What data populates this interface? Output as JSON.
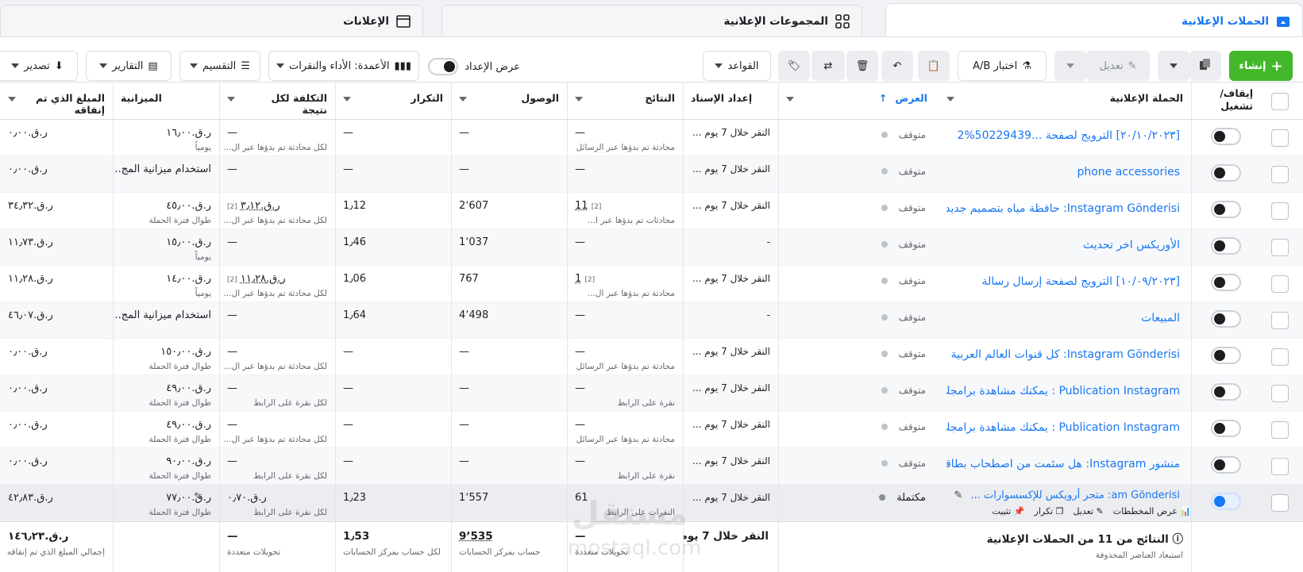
{
  "tabs": [
    {
      "label": "الحملات الإعلانية",
      "icon": "folder-icon"
    },
    {
      "label": "المجموعات الإعلانية",
      "icon": "grid-icon"
    },
    {
      "label": "الإعلانات",
      "icon": "ad-icon"
    }
  ],
  "toolbar": {
    "create": "إنشاء",
    "edit": "تعديل",
    "ab_test": "اختبار A/B",
    "rules": "القواعد",
    "view_setup": "عرض الإعداد",
    "columns": "الأعمدة: الأداء والنقرات",
    "breakdown": "التقسيم",
    "reports": "التقارير",
    "export": "تصدير"
  },
  "headers": {
    "toggle": "إيقاف/ تشغيل",
    "campaign": "الحملة الإعلانية",
    "delivery": "العرض",
    "attribution": "إعداد الإسناد",
    "results": "النتائج",
    "reach": "الوصول",
    "frequency": "التكرار",
    "cost_per_result": "التكلفة لكل نتيجة",
    "budget": "الميزانية",
    "amount_spent": "المبلغ الذي تم إنفاقه"
  },
  "rows": [
    {
      "name": "[٢٠/١٠/٢٠٢٣] الترويج لصفحة ...50229439%2",
      "delivery": "متوقف",
      "attribution": "النقر خلال 7 يوم ...",
      "results": "—",
      "results_sub": "محادثة تم بدؤها عبر الرسائل",
      "reach": "—",
      "frequency": "—",
      "cpr": "—",
      "cpr_sub": "لكل محادثة تم بدؤها عبر ال...",
      "budget": "ر.ق.١٦٫٠٠",
      "budget_sub": "يومياً",
      "spent": "ر.ق.٠٫٠٠"
    },
    {
      "name": "phone accessories",
      "delivery": "متوقف",
      "attribution": "النقر خلال 7 يوم ...",
      "results": "—",
      "results_sub": "",
      "reach": "—",
      "frequency": "—",
      "cpr": "—",
      "cpr_sub": "",
      "budget": "استخدام ميزانية المج...",
      "budget_sub": "",
      "spent": "ر.ق.٠٫٠٠"
    },
    {
      "name": "Instagram Gönderisi: حافظة مياه بتصميم جديد ...",
      "delivery": "متوقف",
      "attribution": "النقر خلال 7 يوم ...",
      "results": "11",
      "results_sub": "محادثات تم بدؤها عبر ا...",
      "reach": "2٬607",
      "frequency": "1٫12",
      "cpr": "ر.ق.٣٫١٢",
      "cpr_sub": "لكل محادثة تم بدؤها عبر ال...",
      "budget": "ر.ق.٤٥٫٠٠",
      "budget_sub": "طوال فترة الحملة",
      "spent": "ر.ق.٣٤٫٣٢"
    },
    {
      "name": "الأوريكس اخر تحديث",
      "delivery": "متوقف",
      "attribution": "-",
      "results": "—",
      "results_sub": "",
      "reach": "1٬037",
      "frequency": "1٫46",
      "cpr": "—",
      "cpr_sub": "",
      "budget": "ر.ق.١٥٫٠٠",
      "budget_sub": "يومياً",
      "spent": "ر.ق.١١٫٧٣"
    },
    {
      "name": "[١٠/٠٩/٢٠٢٣] الترويج لصفحة إرسال رسالة",
      "delivery": "متوقف",
      "attribution": "النقر خلال 7 يوم ...",
      "results": "1",
      "results_sub": "محادثة تم بدؤها عبر ال...",
      "reach": "767",
      "frequency": "1٫06",
      "cpr": "ر.ق.١١٫٢٨",
      "cpr_sub": "لكل محادثة تم بدؤها عبر ال...",
      "budget": "ر.ق.١٤٫٠٠",
      "budget_sub": "يومياً",
      "spent": "ر.ق.١١٫٢٨"
    },
    {
      "name": "المبيعات",
      "delivery": "متوقف",
      "attribution": "-",
      "results": "—",
      "results_sub": "",
      "reach": "4٬498",
      "frequency": "1٫64",
      "cpr": "—",
      "cpr_sub": "",
      "budget": "استخدام ميزانية المج...",
      "budget_sub": "",
      "spent": "ر.ق.٤٦٫٠٧"
    },
    {
      "name": "Instagram Gönderisi: كل قنوات العالم العربية ...",
      "delivery": "متوقف",
      "attribution": "النقر خلال 7 يوم ...",
      "results": "—",
      "results_sub": "محادثة تم بدؤها عبر الرسائل",
      "reach": "—",
      "frequency": "—",
      "cpr": "—",
      "cpr_sub": "لكل محادثة تم بدؤها عبر ال...",
      "budget": "ر.ق.١٥٠٫٠٠",
      "budget_sub": "طوال فترة الحملة",
      "spent": "ر.ق.٠٫٠٠"
    },
    {
      "name": "Publication Instagram : يمكنك مشاهدة برامجك...",
      "delivery": "متوقف",
      "attribution": "النقر خلال 7 يوم ...",
      "results": "—",
      "results_sub": "نقرة على الرابط",
      "reach": "—",
      "frequency": "—",
      "cpr": "—",
      "cpr_sub": "لكل نقرة على الرابط",
      "budget": "ر.ق.٤٩٫٠٠",
      "budget_sub": "طوال فترة الحملة",
      "spent": "ر.ق.٠٫٠٠"
    },
    {
      "name": "Publication Instagram : يمكنك مشاهدة برامجك...",
      "delivery": "متوقف",
      "attribution": "النقر خلال 7 يوم ...",
      "results": "—",
      "results_sub": "محادثة تم بدؤها عبر الرسائل",
      "reach": "—",
      "frequency": "—",
      "cpr": "—",
      "cpr_sub": "لكل محادثة تم بدؤها عبر ال...",
      "budget": "ر.ق.٤٩٫٠٠",
      "budget_sub": "طوال فترة الحملة",
      "spent": "ر.ق.٠٫٠٠"
    },
    {
      "name": "منشور Instagram: هل سئمت من اصطحاب بطاقة ع...",
      "delivery": "متوقف",
      "attribution": "النقر خلال 7 يوم ...",
      "results": "—",
      "results_sub": "نقرة على الرابط",
      "reach": "—",
      "frequency": "—",
      "cpr": "—",
      "cpr_sub": "لكل نقرة على الرابط",
      "budget": "ر.ق.٩٠٫٠٠",
      "budget_sub": "طوال فترة الحملة",
      "spent": "ر.ق.٠٫٠٠"
    },
    {
      "name": "am Gönderisi: متجر أرويكس للإكسسوارات ...",
      "delivery": "مكتملة",
      "attribution": "النقر خلال 7 يوم ...",
      "results": "61",
      "results_sub": "النقرات على الرابط",
      "reach": "1٬557",
      "frequency": "1٫23",
      "cpr": "ر.ق.٠٫٧٠",
      "cpr_sub": "لكل نقرة على الرابط",
      "budget": "ر.ق.٧٧٫٠٠",
      "budget_sub": "طوال فترة الحملة",
      "spent": "ر.ق.٤٢٫٨٣"
    }
  ],
  "row_actions": {
    "charts": "عرض المخططات",
    "edit": "تعديل",
    "duplicate": "تكرار",
    "pin": "تثبيت"
  },
  "footer": {
    "summary": "النتائج من 11 من الحملات الإعلانية",
    "summary_sub": "استبعاد العناصر المحذوفة",
    "attribution": "النقر خلال 7 يوم أ...",
    "results": "—",
    "results_sub": "تحويلات متعددة",
    "reach": "9٬535",
    "reach_sub": "حساب بمركز الحسابات",
    "frequency": "1٫53",
    "frequency_sub": "لكل حساب بمركز الحسابات",
    "cpr": "—",
    "cpr_sub": "تحويلات متعددة",
    "spent": "ر.ق.١٤٦٫٢٣",
    "spent_sub": "إجمالي المبلغ الذي تم إنفاقه"
  },
  "watermark": {
    "logo": "مستقل",
    "url": "mostaql.com"
  },
  "colors": {
    "accent": "#1877f2",
    "create": "#42b72a"
  }
}
